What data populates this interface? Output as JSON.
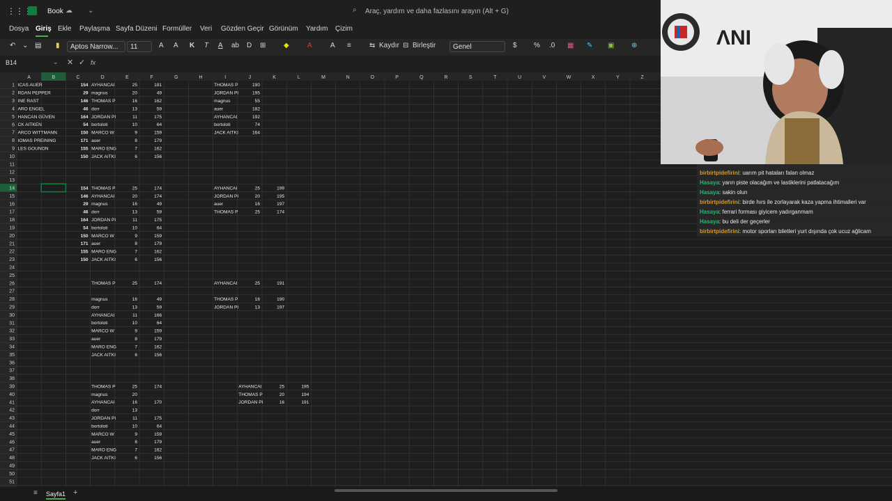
{
  "app": {
    "title": "Book",
    "search_placeholder": "Araç, yardım ve daha fazlasını arayın (Alt + G)"
  },
  "menu": [
    "Dosya",
    "Giriş",
    "Ekle",
    "Paylaşma",
    "Sayfa Düzeni",
    "Formüller",
    "Veri",
    "Gözden Geçir",
    "Görünüm",
    "Yardım",
    "Çizim"
  ],
  "ribbon": {
    "font_name": "Aptos Narrow...",
    "font_size": "11",
    "wrap_label": "Kaydır",
    "merge_label": "Birleştir",
    "number_format": "Genel",
    "bold": "K",
    "italic": "T",
    "underline": "A"
  },
  "formula_bar": {
    "name_box": "B14",
    "fx": "fx",
    "value": ""
  },
  "sheet": {
    "tab_name": "Sayfa1",
    "columns": [
      "A",
      "B",
      "C",
      "D",
      "E",
      "F",
      "G",
      "H",
      "I",
      "J",
      "K",
      "L",
      "M",
      "N",
      "O",
      "P",
      "Q",
      "R",
      "S",
      "T",
      "U",
      "V",
      "W",
      "X",
      "Y",
      "Z"
    ],
    "selected_cell": "B14",
    "cells": [
      {
        "r": 1,
        "c": "A",
        "v": "ICAS AUER"
      },
      {
        "r": 1,
        "c": "C",
        "v": "154",
        "b": 1
      },
      {
        "r": 1,
        "c": "D",
        "v": "AYHANCAI"
      },
      {
        "r": 1,
        "c": "E",
        "v": "25"
      },
      {
        "r": 1,
        "c": "F",
        "v": "181"
      },
      {
        "r": 1,
        "c": "I",
        "v": "THOMAS P"
      },
      {
        "r": 1,
        "c": "J",
        "v": "190"
      },
      {
        "r": 2,
        "c": "A",
        "v": "RDAN PEPPER"
      },
      {
        "r": 2,
        "c": "C",
        "v": "29",
        "b": 1
      },
      {
        "r": 2,
        "c": "D",
        "v": "magnus"
      },
      {
        "r": 2,
        "c": "E",
        "v": "20"
      },
      {
        "r": 2,
        "c": "F",
        "v": "49"
      },
      {
        "r": 2,
        "c": "I",
        "v": "JORDAN PI"
      },
      {
        "r": 2,
        "c": "J",
        "v": "195"
      },
      {
        "r": 3,
        "c": "A",
        "v": "INE RAST"
      },
      {
        "r": 3,
        "c": "C",
        "v": "146",
        "b": 1
      },
      {
        "r": 3,
        "c": "D",
        "v": "THOMAS P"
      },
      {
        "r": 3,
        "c": "E",
        "v": "16"
      },
      {
        "r": 3,
        "c": "F",
        "v": "162"
      },
      {
        "r": 3,
        "c": "I",
        "v": "magnus"
      },
      {
        "r": 3,
        "c": "J",
        "v": "55"
      },
      {
        "r": 4,
        "c": "A",
        "v": "ARO ENGEL"
      },
      {
        "r": 4,
        "c": "C",
        "v": "46",
        "b": 1
      },
      {
        "r": 4,
        "c": "D",
        "v": "dorr"
      },
      {
        "r": 4,
        "c": "E",
        "v": "13"
      },
      {
        "r": 4,
        "c": "F",
        "v": "59"
      },
      {
        "r": 4,
        "c": "I",
        "v": "auer"
      },
      {
        "r": 4,
        "c": "J",
        "v": "182"
      },
      {
        "r": 5,
        "c": "A",
        "v": "HANCAN GÜVEN"
      },
      {
        "r": 5,
        "c": "C",
        "v": "164",
        "b": 1
      },
      {
        "r": 5,
        "c": "D",
        "v": "JORDAN PI"
      },
      {
        "r": 5,
        "c": "E",
        "v": "11"
      },
      {
        "r": 5,
        "c": "F",
        "v": "175"
      },
      {
        "r": 5,
        "c": "I",
        "v": "AYHANCAI"
      },
      {
        "r": 5,
        "c": "J",
        "v": "192"
      },
      {
        "r": 6,
        "c": "A",
        "v": "CK AITKEN"
      },
      {
        "r": 6,
        "c": "C",
        "v": "54",
        "b": 1
      },
      {
        "r": 6,
        "c": "D",
        "v": "bortoloti"
      },
      {
        "r": 6,
        "c": "E",
        "v": "10"
      },
      {
        "r": 6,
        "c": "F",
        "v": "64"
      },
      {
        "r": 6,
        "c": "I",
        "v": "bortoloti"
      },
      {
        "r": 6,
        "c": "J",
        "v": "74"
      },
      {
        "r": 7,
        "c": "A",
        "v": "ARCO WITTMANN"
      },
      {
        "r": 7,
        "c": "C",
        "v": "150",
        "b": 1
      },
      {
        "r": 7,
        "c": "D",
        "v": "MARCO W"
      },
      {
        "r": 7,
        "c": "E",
        "v": "9"
      },
      {
        "r": 7,
        "c": "F",
        "v": "159"
      },
      {
        "r": 7,
        "c": "I",
        "v": "JACK AITKI"
      },
      {
        "r": 7,
        "c": "J",
        "v": "164"
      },
      {
        "r": 8,
        "c": "A",
        "v": "IOMAS PREINING"
      },
      {
        "r": 8,
        "c": "C",
        "v": "171",
        "b": 1
      },
      {
        "r": 8,
        "c": "D",
        "v": "auer"
      },
      {
        "r": 8,
        "c": "E",
        "v": "8"
      },
      {
        "r": 8,
        "c": "F",
        "v": "179"
      },
      {
        "r": 9,
        "c": "A",
        "v": "LES GOUNON"
      },
      {
        "r": 9,
        "c": "C",
        "v": "155",
        "b": 1
      },
      {
        "r": 9,
        "c": "D",
        "v": "MARO ENG"
      },
      {
        "r": 9,
        "c": "E",
        "v": "7"
      },
      {
        "r": 9,
        "c": "F",
        "v": "162"
      },
      {
        "r": 10,
        "c": "C",
        "v": "150",
        "b": 1
      },
      {
        "r": 10,
        "c": "D",
        "v": "JACK AITKI"
      },
      {
        "r": 10,
        "c": "E",
        "v": "6"
      },
      {
        "r": 10,
        "c": "F",
        "v": "156"
      },
      {
        "r": 14,
        "c": "C",
        "v": "154",
        "b": 1
      },
      {
        "r": 14,
        "c": "D",
        "v": "THOMAS P"
      },
      {
        "r": 14,
        "c": "E",
        "v": "25"
      },
      {
        "r": 14,
        "c": "F",
        "v": "174"
      },
      {
        "r": 14,
        "c": "I",
        "v": "AYHANCAI"
      },
      {
        "r": 14,
        "c": "J",
        "v": "25"
      },
      {
        "r": 14,
        "c": "K",
        "v": "199"
      },
      {
        "r": 15,
        "c": "C",
        "v": "146",
        "b": 1
      },
      {
        "r": 15,
        "c": "D",
        "v": "AYHANCAI"
      },
      {
        "r": 15,
        "c": "E",
        "v": "20"
      },
      {
        "r": 15,
        "c": "F",
        "v": "174"
      },
      {
        "r": 15,
        "c": "I",
        "v": "JORDAN PI"
      },
      {
        "r": 15,
        "c": "J",
        "v": "20"
      },
      {
        "r": 15,
        "c": "K",
        "v": "195"
      },
      {
        "r": 16,
        "c": "C",
        "v": "29",
        "b": 1
      },
      {
        "r": 16,
        "c": "D",
        "v": "magnus"
      },
      {
        "r": 16,
        "c": "E",
        "v": "16"
      },
      {
        "r": 16,
        "c": "F",
        "v": "49"
      },
      {
        "r": 16,
        "c": "I",
        "v": "auer"
      },
      {
        "r": 16,
        "c": "J",
        "v": "16"
      },
      {
        "r": 16,
        "c": "K",
        "v": "197"
      },
      {
        "r": 17,
        "c": "C",
        "v": "46",
        "b": 1
      },
      {
        "r": 17,
        "c": "D",
        "v": "dorr"
      },
      {
        "r": 17,
        "c": "E",
        "v": "13"
      },
      {
        "r": 17,
        "c": "F",
        "v": "59"
      },
      {
        "r": 17,
        "c": "I",
        "v": "THOMAS P"
      },
      {
        "r": 17,
        "c": "J",
        "v": "25"
      },
      {
        "r": 17,
        "c": "K",
        "v": "174"
      },
      {
        "r": 18,
        "c": "C",
        "v": "164",
        "b": 1
      },
      {
        "r": 18,
        "c": "D",
        "v": "JORDAN PI"
      },
      {
        "r": 18,
        "c": "E",
        "v": "11"
      },
      {
        "r": 18,
        "c": "F",
        "v": "175"
      },
      {
        "r": 19,
        "c": "C",
        "v": "54",
        "b": 1
      },
      {
        "r": 19,
        "c": "D",
        "v": "bortoloti"
      },
      {
        "r": 19,
        "c": "E",
        "v": "10"
      },
      {
        "r": 19,
        "c": "F",
        "v": "64"
      },
      {
        "r": 20,
        "c": "C",
        "v": "150",
        "b": 1
      },
      {
        "r": 20,
        "c": "D",
        "v": "MARCO W"
      },
      {
        "r": 20,
        "c": "E",
        "v": "9"
      },
      {
        "r": 20,
        "c": "F",
        "v": "159"
      },
      {
        "r": 21,
        "c": "C",
        "v": "171",
        "b": 1
      },
      {
        "r": 21,
        "c": "D",
        "v": "auer"
      },
      {
        "r": 21,
        "c": "E",
        "v": "8"
      },
      {
        "r": 21,
        "c": "F",
        "v": "179"
      },
      {
        "r": 22,
        "c": "C",
        "v": "155",
        "b": 1
      },
      {
        "r": 22,
        "c": "D",
        "v": "MARO ENG"
      },
      {
        "r": 22,
        "c": "E",
        "v": "7"
      },
      {
        "r": 22,
        "c": "F",
        "v": "162"
      },
      {
        "r": 23,
        "c": "C",
        "v": "150",
        "b": 1
      },
      {
        "r": 23,
        "c": "D",
        "v": "JACK AITKI"
      },
      {
        "r": 23,
        "c": "E",
        "v": "6"
      },
      {
        "r": 23,
        "c": "F",
        "v": "156"
      },
      {
        "r": 26,
        "c": "D",
        "v": "THOMAS P"
      },
      {
        "r": 26,
        "c": "E",
        "v": "25"
      },
      {
        "r": 26,
        "c": "F",
        "v": "174"
      },
      {
        "r": 26,
        "c": "I",
        "v": "AYHANCAI"
      },
      {
        "r": 26,
        "c": "J",
        "v": "25"
      },
      {
        "r": 26,
        "c": "K",
        "v": "191"
      },
      {
        "r": 28,
        "c": "D",
        "v": "magnus"
      },
      {
        "r": 28,
        "c": "E",
        "v": "16"
      },
      {
        "r": 28,
        "c": "F",
        "v": "49"
      },
      {
        "r": 28,
        "c": "I",
        "v": "THOMAS P"
      },
      {
        "r": 28,
        "c": "J",
        "v": "16"
      },
      {
        "r": 28,
        "c": "K",
        "v": "190"
      },
      {
        "r": 29,
        "c": "D",
        "v": "dorr"
      },
      {
        "r": 29,
        "c": "E",
        "v": "13"
      },
      {
        "r": 29,
        "c": "F",
        "v": "59"
      },
      {
        "r": 29,
        "c": "I",
        "v": "JORDAN PI"
      },
      {
        "r": 29,
        "c": "J",
        "v": "13"
      },
      {
        "r": 29,
        "c": "K",
        "v": "197"
      },
      {
        "r": 30,
        "c": "D",
        "v": "AYHANCAI"
      },
      {
        "r": 30,
        "c": "E",
        "v": "11"
      },
      {
        "r": 30,
        "c": "F",
        "v": "166"
      },
      {
        "r": 31,
        "c": "D",
        "v": "bortoloti"
      },
      {
        "r": 31,
        "c": "E",
        "v": "10"
      },
      {
        "r": 31,
        "c": "F",
        "v": "64"
      },
      {
        "r": 32,
        "c": "D",
        "v": "MARCO W"
      },
      {
        "r": 32,
        "c": "E",
        "v": "9"
      },
      {
        "r": 32,
        "c": "F",
        "v": "159"
      },
      {
        "r": 33,
        "c": "D",
        "v": "auer"
      },
      {
        "r": 33,
        "c": "E",
        "v": "8"
      },
      {
        "r": 33,
        "c": "F",
        "v": "179"
      },
      {
        "r": 34,
        "c": "D",
        "v": "MARO ENG"
      },
      {
        "r": 34,
        "c": "E",
        "v": "7"
      },
      {
        "r": 34,
        "c": "F",
        "v": "162"
      },
      {
        "r": 35,
        "c": "D",
        "v": "JACK AITKI"
      },
      {
        "r": 35,
        "c": "E",
        "v": "6"
      },
      {
        "r": 35,
        "c": "F",
        "v": "156"
      },
      {
        "r": 39,
        "c": "D",
        "v": "THOMAS P"
      },
      {
        "r": 39,
        "c": "E",
        "v": "25"
      },
      {
        "r": 39,
        "c": "F",
        "v": "174"
      },
      {
        "r": 39,
        "c": "J",
        "v": "AYHANCAI"
      },
      {
        "r": 39,
        "c": "K",
        "v": "25"
      },
      {
        "r": 39,
        "c": "L",
        "v": "195"
      },
      {
        "r": 40,
        "c": "D",
        "v": "magnus"
      },
      {
        "r": 40,
        "c": "E",
        "v": "20"
      },
      {
        "r": 40,
        "c": "J",
        "v": "THOMAS P"
      },
      {
        "r": 40,
        "c": "K",
        "v": "20"
      },
      {
        "r": 40,
        "c": "L",
        "v": "194"
      },
      {
        "r": 41,
        "c": "D",
        "v": "AYHANCAI"
      },
      {
        "r": 41,
        "c": "E",
        "v": "16"
      },
      {
        "r": 41,
        "c": "F",
        "v": "170"
      },
      {
        "r": 41,
        "c": "J",
        "v": "JORDAN PI"
      },
      {
        "r": 41,
        "c": "K",
        "v": "16"
      },
      {
        "r": 41,
        "c": "L",
        "v": "191"
      },
      {
        "r": 42,
        "c": "D",
        "v": "dorr"
      },
      {
        "r": 42,
        "c": "E",
        "v": "13"
      },
      {
        "r": 43,
        "c": "D",
        "v": "JORDAN PI"
      },
      {
        "r": 43,
        "c": "E",
        "v": "11"
      },
      {
        "r": 43,
        "c": "F",
        "v": "175"
      },
      {
        "r": 44,
        "c": "D",
        "v": "bortoloti"
      },
      {
        "r": 44,
        "c": "E",
        "v": "10"
      },
      {
        "r": 44,
        "c": "F",
        "v": "64"
      },
      {
        "r": 45,
        "c": "D",
        "v": "MARCO W"
      },
      {
        "r": 45,
        "c": "E",
        "v": "9"
      },
      {
        "r": 45,
        "c": "F",
        "v": "159"
      },
      {
        "r": 46,
        "c": "D",
        "v": "auer"
      },
      {
        "r": 46,
        "c": "E",
        "v": "8"
      },
      {
        "r": 46,
        "c": "F",
        "v": "179"
      },
      {
        "r": 47,
        "c": "D",
        "v": "MARO ENG"
      },
      {
        "r": 47,
        "c": "E",
        "v": "7"
      },
      {
        "r": 47,
        "c": "F",
        "v": "162"
      },
      {
        "r": 48,
        "c": "D",
        "v": "JACK AITKI"
      },
      {
        "r": 48,
        "c": "E",
        "v": "6"
      },
      {
        "r": 48,
        "c": "F",
        "v": "156"
      }
    ]
  },
  "chat": [
    {
      "user": "birbirtpidefirini",
      "msg": ": uarım pit hataları falan olmaz",
      "color": "#d49a2b"
    },
    {
      "user": "Hasaya",
      "msg": ": yarın piste olacağım ve lastiklerini patlatacağım",
      "color": "#2bb673"
    },
    {
      "user": "Hasaya",
      "msg": ": sakin olun",
      "color": "#2bb673"
    },
    {
      "user": "birbirtpidefirini",
      "msg": ": birde hırs ile zorlayarak kaza yapma ihtimalleri var",
      "color": "#d49a2b"
    },
    {
      "user": "Hasaya",
      "msg": ": ferrari forması giyicem yadırganmam",
      "color": "#2bb673"
    },
    {
      "user": "Hasaya",
      "msg": ": bu deli der geçerler",
      "color": "#2bb673"
    },
    {
      "user": "birbirtpidefirini",
      "msg": ": motor sporları biletleri yurt dışında çok ucuz ağlicam",
      "color": "#d49a2b"
    }
  ],
  "colors": {
    "accent_green": "#107c41",
    "grid_line": "#3a3a3a",
    "header_bg": "#262626",
    "selected_header": "#1e5e3a"
  }
}
